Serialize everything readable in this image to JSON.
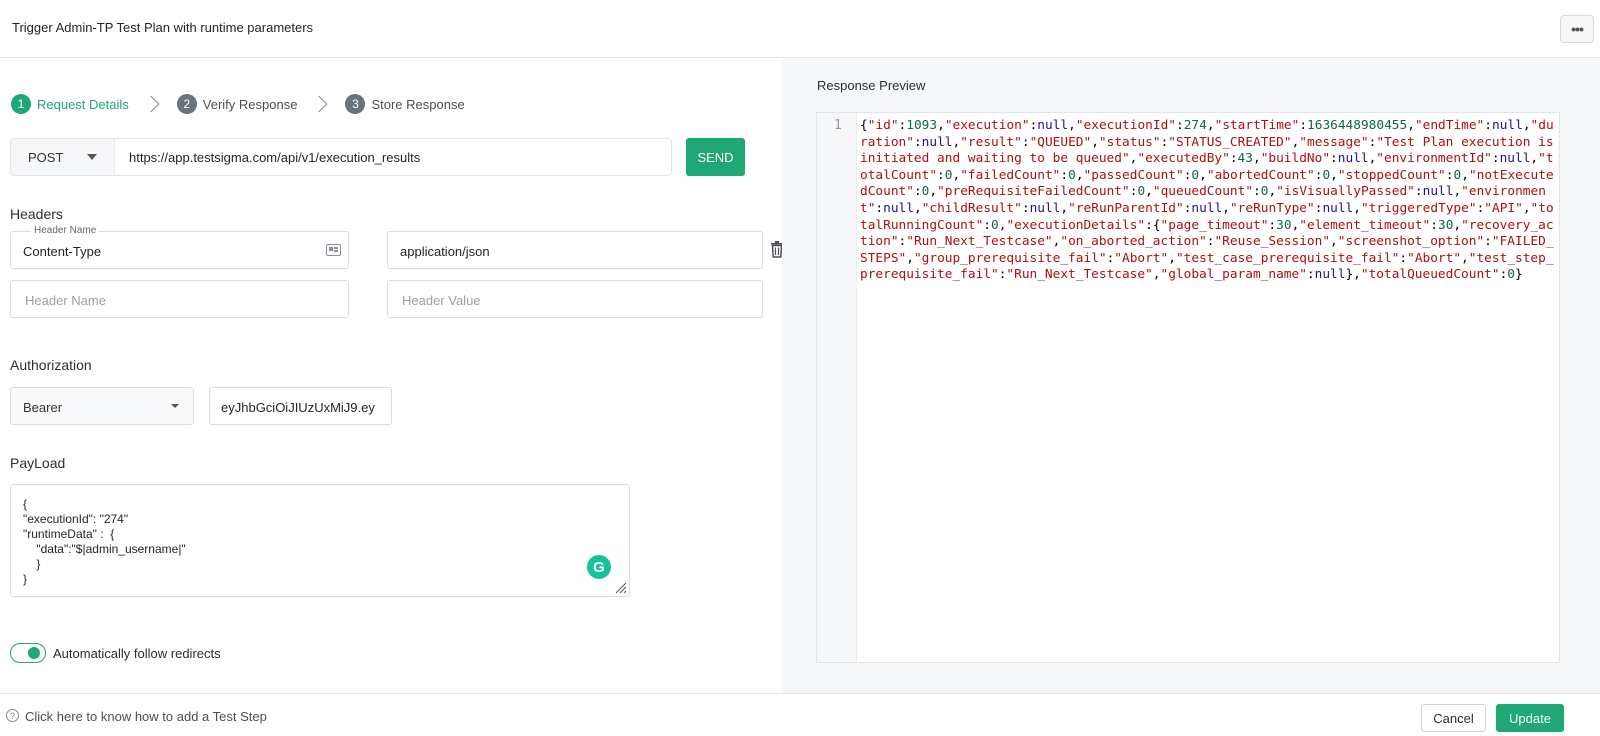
{
  "header": {
    "title": "Trigger Admin-TP Test Plan with runtime parameters",
    "more_icon": "ellipsis-icon"
  },
  "stepper": [
    {
      "number": "1",
      "label": "Request Details",
      "active": true
    },
    {
      "number": "2",
      "label": "Verify Response",
      "active": false
    },
    {
      "number": "3",
      "label": "Store Response",
      "active": false
    }
  ],
  "request": {
    "method": "POST",
    "url": "https://app.testsigma.com/api/v1/execution_results",
    "send_label": "SEND"
  },
  "headers": {
    "title": "Headers",
    "header_name_label": "Header Name",
    "rows": [
      {
        "name": "Content-Type",
        "value": "application/json"
      }
    ],
    "name_placeholder": "Header Name",
    "value_placeholder": "Header Value"
  },
  "authorization": {
    "title": "Authorization",
    "type": "Bearer",
    "token": "eyJhbGciOiJIUzUxMiJ9.ey"
  },
  "payload": {
    "title": "PayLoad",
    "lines": [
      "{",
      "\"executionId\": \"274\"",
      "\"runtimeData\" :  {",
      "    \"data\":\"$|admin_username|\"",
      "    }",
      "}"
    ]
  },
  "redirects": {
    "label": "Automatically follow redirects",
    "enabled": true
  },
  "response": {
    "title": "Response Preview",
    "line_number": "1",
    "body": "{\"id\":1093,\"execution\":null,\"executionId\":274,\"startTime\":1636448980455,\"endTime\":null,\"duration\":null,\"result\":\"QUEUED\",\"status\":\"STATUS_CREATED\",\"message\":\"Test Plan execution is initiated and waiting to be queued\",\"executedBy\":43,\"buildNo\":null,\"environmentId\":null,\"totalCount\":0,\"failedCount\":0,\"passedCount\":0,\"abortedCount\":0,\"stoppedCount\":0,\"notExecutedCount\":0,\"preRequisiteFailedCount\":0,\"queuedCount\":0,\"isVisuallyPassed\":null,\"environment\":null,\"childResult\":null,\"reRunParentId\":null,\"reRunType\":null,\"triggeredType\":\"API\",\"totalRunningCount\":0,\"executionDetails\":{\"page_timeout\":30,\"element_timeout\":30,\"recovery_action\":\"Run_Next_Testcase\",\"on_aborted_action\":\"Reuse_Session\",\"screenshot_option\":\"FAILED_STEPS\",\"group_prerequisite_fail\":\"Abort\",\"test_case_prerequisite_fail\":\"Abort\",\"test_step_prerequisite_fail\":\"Run_Next_Testcase\",\"global_param_name\":null},\"totalQueuedCount\":0}"
  },
  "footer": {
    "help_text": "Click here to know how to add a Test Step",
    "cancel_label": "Cancel",
    "update_label": "Update"
  },
  "colors": {
    "accent": "#1fa774",
    "json_key": "#aa1111",
    "json_number": "#116644",
    "json_null": "#221199"
  }
}
